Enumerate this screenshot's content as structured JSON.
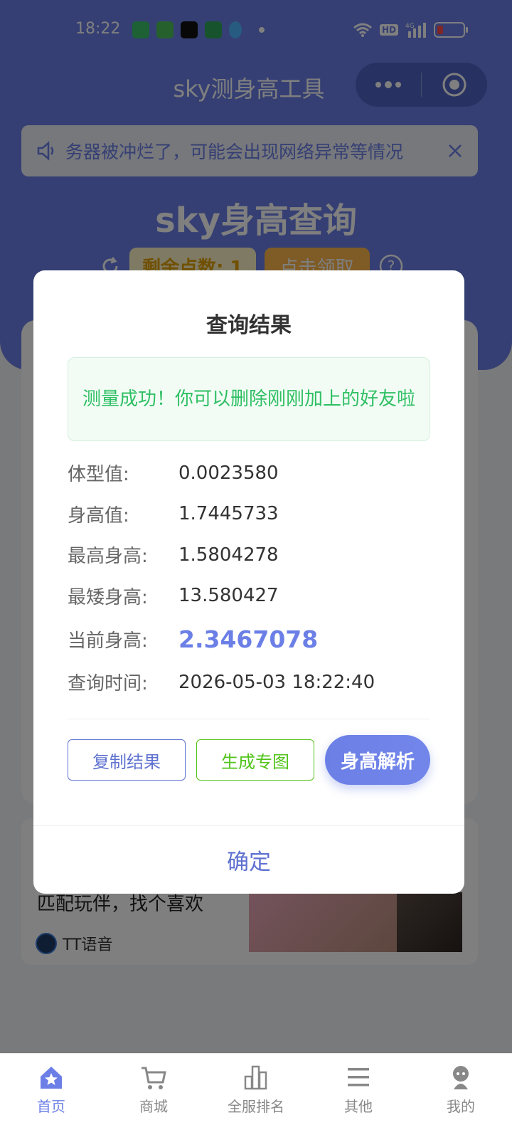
{
  "status_bar": {
    "time": "18:22",
    "hd": "HD",
    "network": "4G"
  },
  "nav": {
    "title": "sky测身高工具"
  },
  "background": {
    "notice_text": "务器被冲烂了，可能会出现网络异常等情况",
    "hero_title": "sky身高查询",
    "points_label": "剩余点数: 1",
    "claim_label": "点击领取",
    "ad_title": "匹配玩伴，找个喜欢",
    "ad_brand": "TT语音"
  },
  "modal": {
    "title": "查询结果",
    "success_message": "测量成功！你可以删除刚刚加上的好友啦",
    "results": [
      {
        "label": "体型值:",
        "value": "0.0023580"
      },
      {
        "label": "身高值:",
        "value": "1.7445733"
      },
      {
        "label": "最高身高:",
        "value": "1.5804278"
      },
      {
        "label": "最矮身高:",
        "value": "13.580427"
      },
      {
        "label": "当前身高:",
        "value": "2.3467078"
      },
      {
        "label": "查询时间:",
        "value": "2026-05-03 18:22:40"
      }
    ],
    "copy_button": "复制结果",
    "image_button": "生成专图",
    "analyze_button": "身高解析",
    "confirm_button": "确定"
  },
  "tabs": [
    {
      "label": "首页",
      "icon": "home-icon",
      "active": true
    },
    {
      "label": "商城",
      "icon": "cart-icon",
      "active": false
    },
    {
      "label": "全服排名",
      "icon": "chart-icon",
      "active": false
    },
    {
      "label": "其他",
      "icon": "menu-icon",
      "active": false
    },
    {
      "label": "我的",
      "icon": "profile-icon",
      "active": false
    }
  ],
  "colors": {
    "primary": "#6b7fe6",
    "success": "#2fbf63",
    "green_button": "#52c41a"
  }
}
